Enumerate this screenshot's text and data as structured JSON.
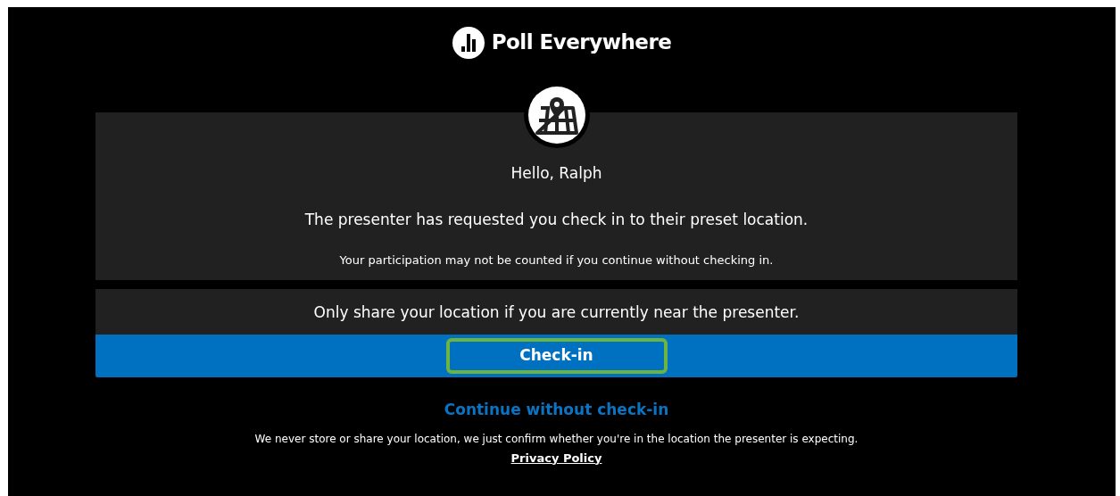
{
  "brand": {
    "name": "Poll Everywhere"
  },
  "checkin_card": {
    "greeting": "Hello, Ralph",
    "message": "The presenter has requested you check in to their preset location.",
    "warning": "Your participation may not be counted if you continue without checking in."
  },
  "share_card": {
    "notice": "Only share your location if you are currently near the presenter.",
    "button": {
      "label": "Check-in",
      "highlighted": true
    }
  },
  "skip_link": "Continue without check-in",
  "privacy_note": "We never store or share your location, we just confirm whether you're in the location the presenter is expecting.",
  "privacy_link": "Privacy Policy"
}
